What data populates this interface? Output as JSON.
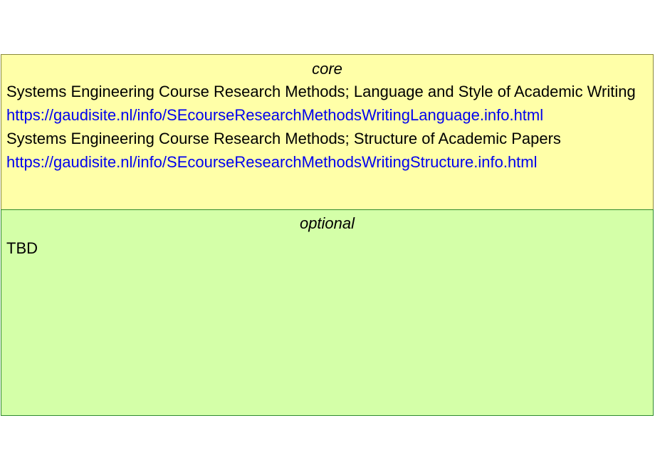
{
  "core": {
    "title": "core",
    "entries": [
      {
        "title": "Systems Engineering Course Research Methods; Language and Style of Academic Writing",
        "url": "https://gaudisite.nl/info/SEcourseResearchMethodsWritingLanguage.info.html"
      },
      {
        "title": "Systems Engineering Course Research Methods; Structure of Academic Papers",
        "url": "https://gaudisite.nl/info/SEcourseResearchMethodsWritingStructure.info.html"
      }
    ]
  },
  "optional": {
    "title": "optional",
    "content": "TBD"
  },
  "colors": {
    "core_background": "#ffffa8",
    "optional_background": "#d4ffa8",
    "link": "#0000ee"
  }
}
